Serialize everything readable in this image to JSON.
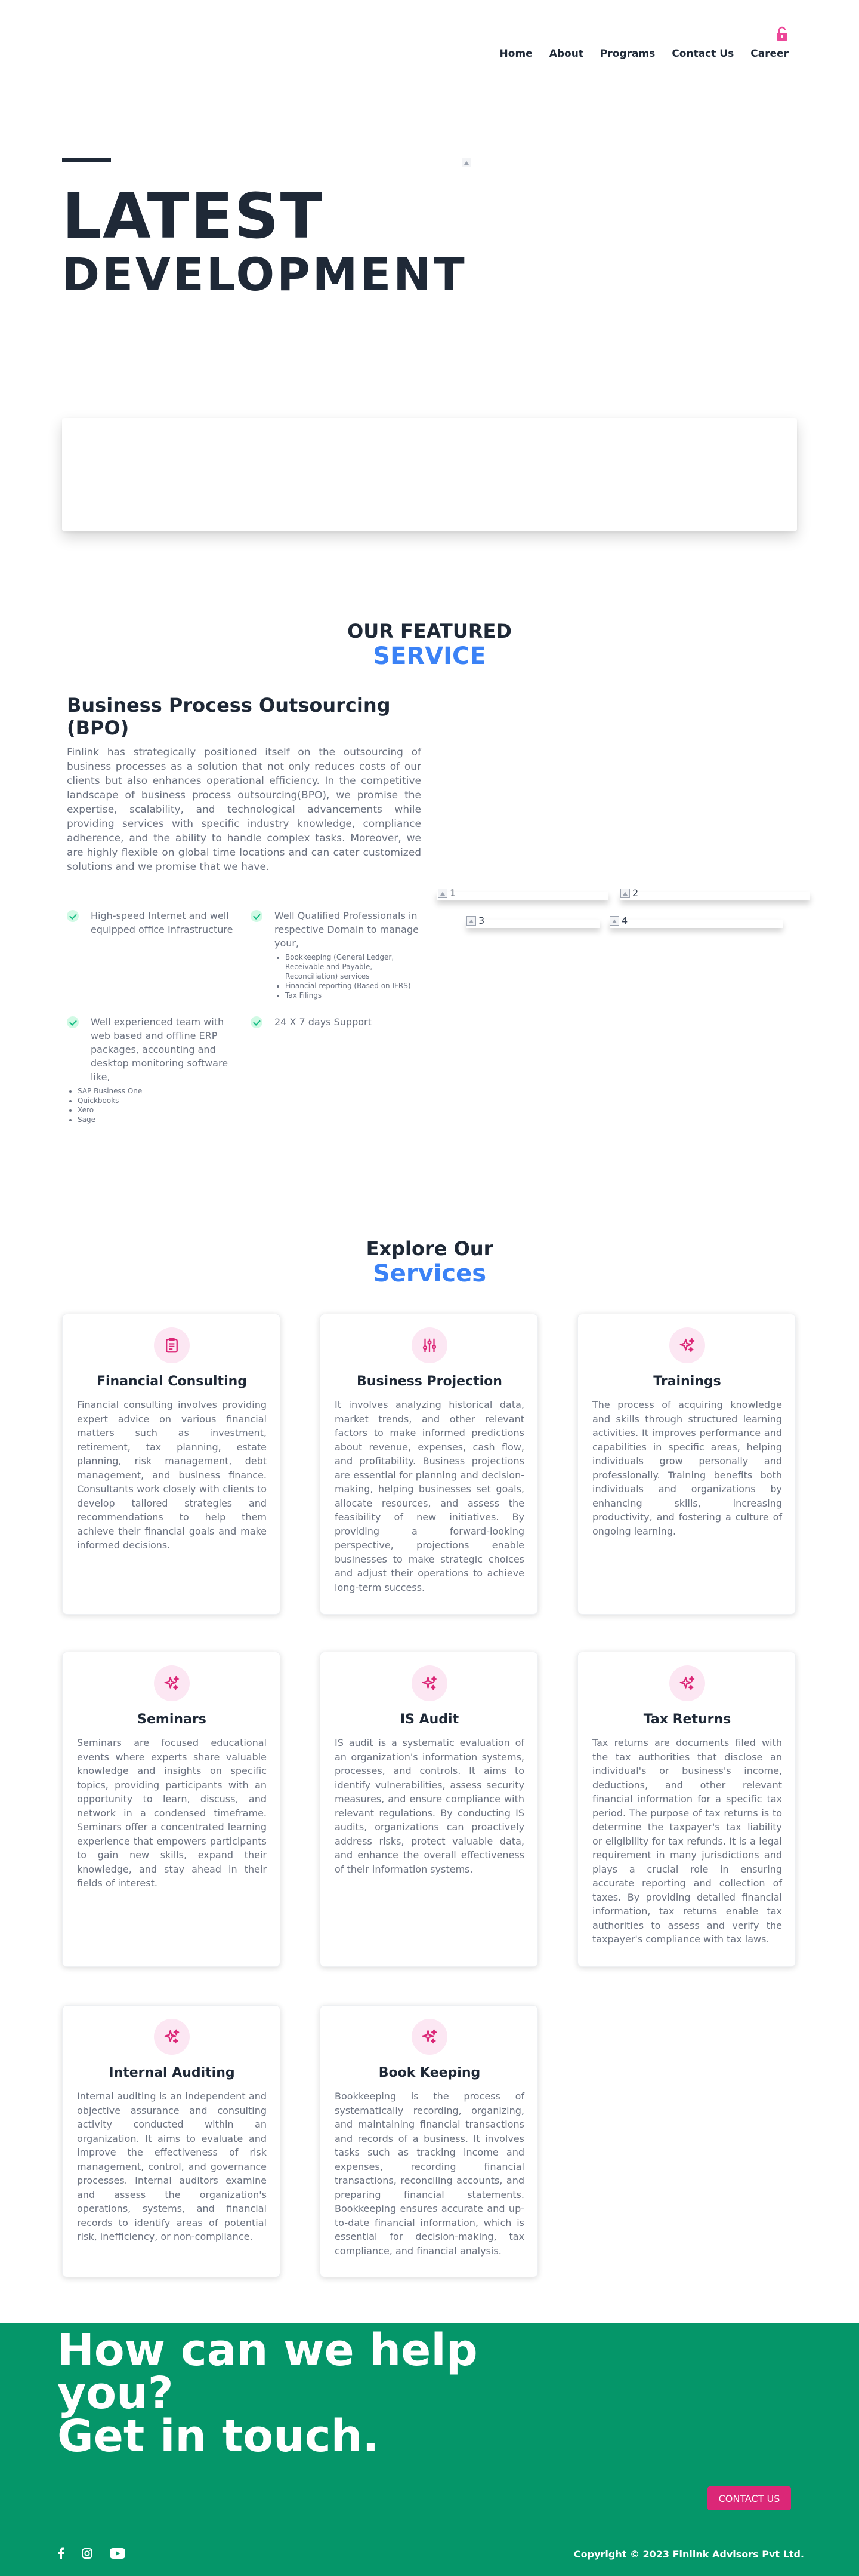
{
  "nav": {
    "items": [
      "Home",
      "About",
      "Programs",
      "Contact Us",
      "Career"
    ]
  },
  "hero": {
    "title_line1": "LATEST",
    "title_line2": "DEVELOPMENT"
  },
  "featured": {
    "heading": "OUR FEATURED",
    "subheading": "SERVICE",
    "title": "Business Process Outsourcing (BPO)",
    "description": "Finlink has strategically positioned itself on the outsourcing of business processes as a solution that not only reduces costs of our clients but also enhances operational efficiency. In the competitive landscape of business process outsourcing(BPO), we promise the expertise, scalability, and technological advancements while providing services with specific industry knowledge, compliance adherence, and the ability to handle complex tasks. Moreover, we are highly flexible on global time locations and can cater customized solutions and we promise that we have.",
    "features": [
      {
        "text": "High-speed Internet and well equipped office Infrastructure",
        "subitems": []
      },
      {
        "text": "Well Qualified Professionals in respective Domain to manage your,",
        "subitems": [
          "Bookkeeping (General Ledger, Receivable and Payable, Reconciliation) services",
          "Financial reporting (Based on IFRS)",
          "Tax Filings"
        ]
      },
      {
        "text": "Well experienced team with web based and offline ERP packages, accounting and desktop monitoring software like,",
        "subitems": [
          "SAP Business One",
          "Quickbooks",
          "Xero",
          "Sage"
        ]
      },
      {
        "text": "24 X 7 days Support",
        "subitems": []
      }
    ],
    "image_alts": [
      "1",
      "2",
      "3",
      "4"
    ]
  },
  "services": {
    "heading": "Explore Our",
    "subheading": "Services",
    "cards": [
      {
        "title": "Financial Consulting",
        "icon": "clipboard-icon",
        "text": "Financial consulting involves providing expert advice on various financial matters such as investment, retirement, tax planning, estate planning, risk management, debt management, and business finance. Consultants work closely with clients to develop tailored strategies and recommendations to help them achieve their financial goals and make informed decisions."
      },
      {
        "title": "Business Projection",
        "icon": "sliders-icon",
        "text": "It involves analyzing historical data, market trends, and other relevant factors to make informed predictions about revenue, expenses, cash flow, and profitability. Business projections are essential for planning and decision-making, helping businesses set goals, allocate resources, and assess the feasibility of new initiatives. By providing a forward-looking perspective, projections enable businesses to make strategic choices and adjust their operations to achieve long-term success."
      },
      {
        "title": "Trainings",
        "icon": "sparkles-icon",
        "text": "The process of acquiring knowledge and skills through structured learning activities. It improves performance and capabilities in specific areas, helping individuals grow personally and professionally. Training benefits both individuals and organizations by enhancing skills, increasing productivity, and fostering a culture of ongoing learning."
      },
      {
        "title": "Seminars",
        "icon": "sparkles-icon",
        "text": "Seminars are focused educational events where experts share valuable knowledge and insights on specific topics, providing participants with an opportunity to learn, discuss, and network in a condensed timeframe. Seminars offer a concentrated learning experience that empowers participants to gain new skills, expand their knowledge, and stay ahead in their fields of interest."
      },
      {
        "title": "IS Audit",
        "icon": "sparkles-icon",
        "text": "IS audit is a systematic evaluation of an organization's information systems, processes, and controls. It aims to identify vulnerabilities, assess security measures, and ensure compliance with relevant regulations. By conducting IS audits, organizations can proactively address risks, protect valuable data, and enhance the overall effectiveness of their information systems."
      },
      {
        "title": "Tax Returns",
        "icon": "sparkles-icon",
        "text": "Tax returns are documents filed with the tax authorities that disclose an individual's or business's income, deductions, and other relevant financial information for a specific tax period. The purpose of tax returns is to determine the taxpayer's tax liability or eligibility for tax refunds. It is a legal requirement in many jurisdictions and plays a crucial role in ensuring accurate reporting and collection of taxes. By providing detailed financial information, tax returns enable tax authorities to assess and verify the taxpayer's compliance with tax laws."
      },
      {
        "title": "Internal Auditing",
        "icon": "sparkles-icon",
        "text": "Internal auditing is an independent and objective assurance and consulting activity conducted within an organization. It aims to evaluate and improve the effectiveness of risk management, control, and governance processes. Internal auditors examine and assess the organization's operations, systems, and financial records to identify areas of potential risk, inefficiency, or non-compliance."
      },
      {
        "title": "Book Keeping",
        "icon": "sparkles-icon",
        "text": "Bookkeeping is the process of systematically recording, organizing, and maintaining financial transactions and records of a business. It involves tasks such as tracking income and expenses, recording financial transactions, reconciling accounts, and preparing financial statements. Bookkeeping ensures accurate and up-to-date financial information, which is essential for decision-making, tax compliance, and financial analysis."
      }
    ]
  },
  "footer": {
    "headline_line1": "How can we help",
    "headline_line2": "you?",
    "headline_line3": "Get in touch.",
    "contact_button": "CONTACT US",
    "copyright": "Copyright © 2023 Finlink Advisors Pvt Ltd.",
    "social": [
      "facebook-icon",
      "instagram-icon",
      "youtube-icon"
    ]
  },
  "colors": {
    "accent_blue": "#3b82f6",
    "accent_pink": "#db2777",
    "footer_green": "#059669",
    "dark_text": "#1f2937"
  }
}
